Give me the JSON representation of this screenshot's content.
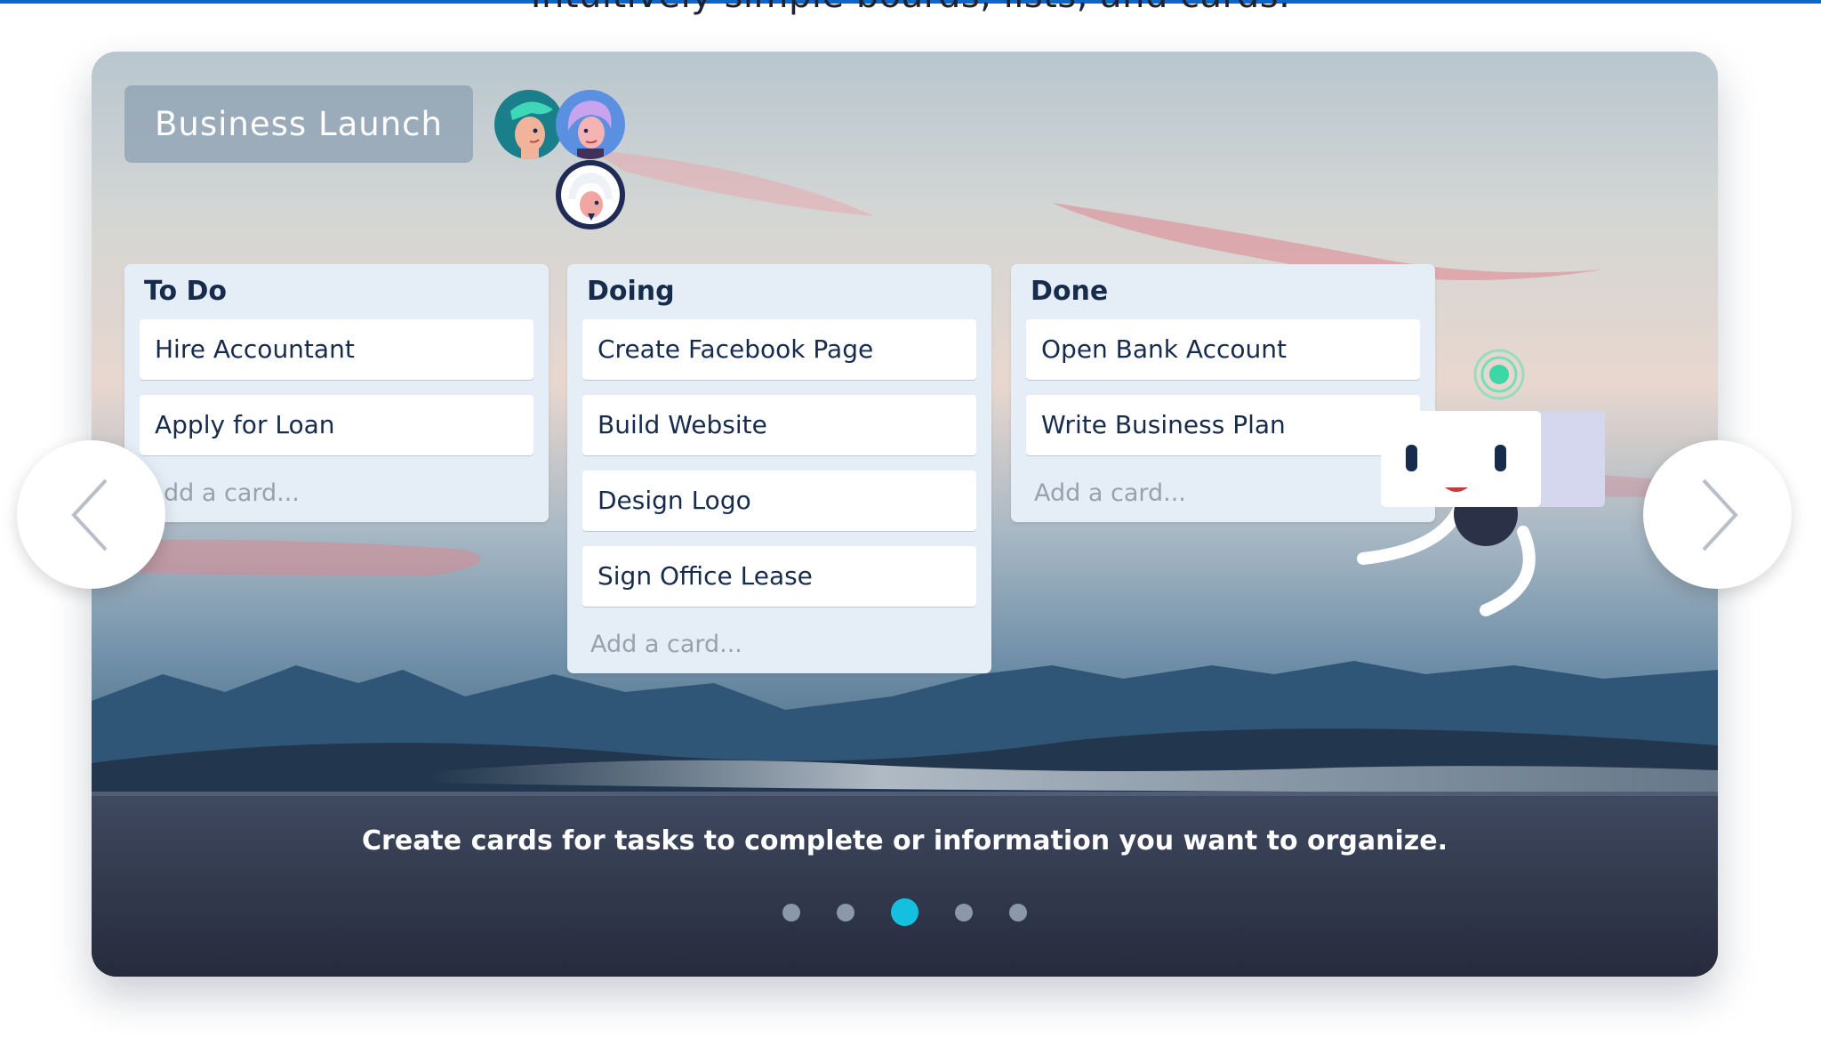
{
  "header": {
    "heading": "Intuitively simple boards, lists, and cards."
  },
  "board": {
    "title": "Business Launch",
    "members": [
      "member-avatar-teal",
      "member-avatar-purple",
      "member-avatar-helmet"
    ],
    "lists": [
      {
        "title": "To Do",
        "cards": [
          "Hire Accountant",
          "Apply for Loan"
        ],
        "add_card": "Add a card..."
      },
      {
        "title": "Doing",
        "cards": [
          "Create Facebook Page",
          "Build Website",
          "Design Logo",
          "Sign Office Lease"
        ],
        "add_card": "Add a card..."
      },
      {
        "title": "Done",
        "cards": [
          "Open Bank Account",
          "Write Business Plan"
        ],
        "add_card": "Add a card..."
      }
    ]
  },
  "carousel": {
    "caption": "Create cards for tasks to complete or information you want to organize.",
    "slide_count": 5,
    "active_slide": 3,
    "prev_icon": "chevron-left-icon",
    "next_icon": "chevron-right-icon"
  },
  "colors": {
    "accent": "#14c0e0",
    "top_bar": "#0c66c8",
    "list_background": "#e5eef6",
    "caption_band": "#2d3347",
    "inactive_dot": "#8a98aa"
  }
}
